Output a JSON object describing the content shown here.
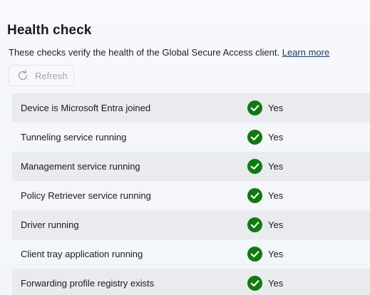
{
  "header": {
    "title": "Health check",
    "description": "These checks verify the health of the Global Secure Access client.",
    "learn_more": "Learn more"
  },
  "toolbar": {
    "refresh_label": "Refresh",
    "refresh_icon": "refresh-icon"
  },
  "colors": {
    "check_green": "#0f7b0f",
    "row_shade": "#e9ebef",
    "link": "#1a3c67"
  },
  "checks": [
    {
      "label": "Device is Microsoft Entra joined",
      "status": "Yes",
      "icon": "check-circle-icon"
    },
    {
      "label": "Tunneling service running",
      "status": "Yes",
      "icon": "check-circle-icon"
    },
    {
      "label": "Management service running",
      "status": "Yes",
      "icon": "check-circle-icon"
    },
    {
      "label": "Policy Retriever service running",
      "status": "Yes",
      "icon": "check-circle-icon"
    },
    {
      "label": "Driver running",
      "status": "Yes",
      "icon": "check-circle-icon"
    },
    {
      "label": "Client tray application running",
      "status": "Yes",
      "icon": "check-circle-icon"
    },
    {
      "label": "Forwarding profile registry exists",
      "status": "Yes",
      "icon": "check-circle-icon"
    }
  ]
}
